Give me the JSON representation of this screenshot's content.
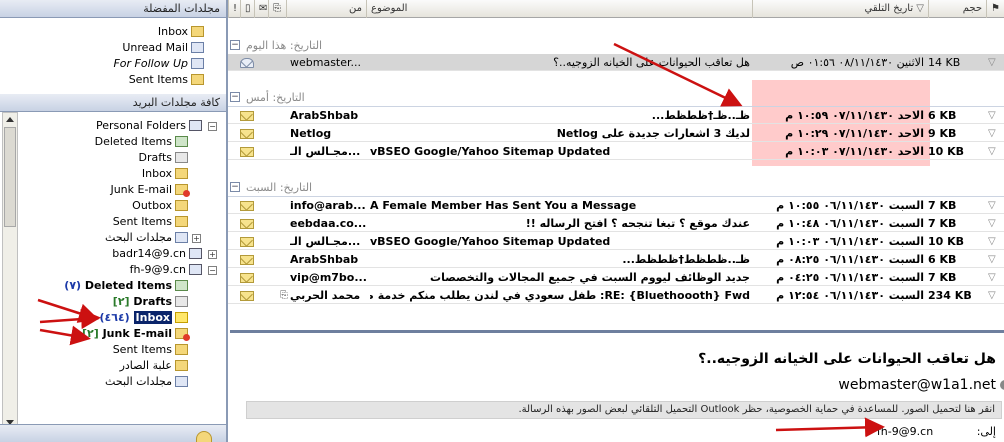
{
  "columns": {
    "size": "حجم",
    "received": "تاريخ التلقي",
    "subject": "الموضوع",
    "from": "من"
  },
  "groups": [
    {
      "label": "التاريخ: هذا اليوم"
    },
    {
      "label": "التاريخ: أمس"
    },
    {
      "label": "التاريخ: السبت"
    }
  ],
  "messages": [
    {
      "from": "webmaster...",
      "subject": "هل تعاقب الحيوانات على الخيانه الزوجيه..؟",
      "received": "الاثنين ٠٨/١١/١٤٣٠ ٠١:٥٦ ص",
      "size": "14 KB",
      "read": true,
      "selected": true,
      "attachment": false
    },
    {
      "from": "ArabShbab",
      "subject": "ظـ..ظـ†ظطظط...",
      "received": "الاحد ٠٧/١١/١٤٣٠ ١٠:٥٩ م",
      "size": "6 KB",
      "read": false,
      "selected": false,
      "attachment": false
    },
    {
      "from": "Netlog",
      "subject": "لديك 3 اشعارات جديدة على Netlog",
      "received": "الاحد ٠٧/١١/١٤٣٠ ١٠:٢٩ م",
      "size": "9 KB",
      "read": false,
      "selected": false,
      "attachment": false
    },
    {
      "from": "مجـالس الـ...",
      "subject": "vBSEO Google/Yahoo Sitemap Updated",
      "received": "الاحد ٠٧/١١/١٤٣٠ ١٠:٠٣ م",
      "size": "10 KB",
      "read": false,
      "selected": false,
      "attachment": false
    },
    {
      "from": "info@arab...",
      "subject": "A Female Member Has Sent You a Message",
      "received": "السبت ٠٦/١١/١٤٣٠ ١٠:٥٥ م",
      "size": "7 KB",
      "read": false,
      "selected": false,
      "attachment": false
    },
    {
      "from": "eebdaa.co...",
      "subject": "عندك موقع ؟ تبغا تنجحه ؟ افتح الرساله !!",
      "received": "السبت ٠٦/١١/١٤٣٠ ١٠:٤٨ م",
      "size": "7 KB",
      "read": false,
      "selected": false,
      "attachment": false
    },
    {
      "from": "مجـالس الـ...",
      "subject": "vBSEO Google/Yahoo Sitemap Updated",
      "received": "السبت ٠٦/١١/١٤٣٠ ١٠:٠٣ م",
      "size": "10 KB",
      "read": false,
      "selected": false,
      "attachment": false
    },
    {
      "from": "ArabShbab",
      "subject": "ظـ..ظطظط†ظطظط...",
      "received": "السبت ٠٦/١١/١٤٣٠ ٠٨:٢٥ م",
      "size": "6 KB",
      "read": false,
      "selected": false,
      "attachment": false
    },
    {
      "from": "vip@m7bo...",
      "subject": "جديد الوظائف ليووم السبت في جميع المجالات والتخصصات",
      "received": "السبت ٠٦/١١/١٤٣٠ ٠٤:٢٥ م",
      "size": "7 KB",
      "read": false,
      "selected": false,
      "attachment": false
    },
    {
      "from": "محمد الحربي",
      "subject": "RE: {Bluethoooth} Fwd: طفل سعودي في لندن يطلب منكم خدمة صغيرة",
      "received": "السبت ٠٦/١١/١٤٣٠ ١٢:٥٤ م",
      "size": "234 KB",
      "read": false,
      "selected": false,
      "attachment": true
    }
  ],
  "folders_pane": {
    "favorites_title": "مجلدات المفضلة",
    "favorites": [
      "Inbox",
      "Unread Mail",
      "For Follow Up",
      "Sent Items"
    ],
    "all_title": "كافة مجلدات البريد",
    "personal": "Personal Folders",
    "personal_items": [
      "Deleted Items",
      "Drafts",
      "Inbox",
      "Junk E-mail",
      "Outbox",
      "Sent Items",
      "مجلدات البحث"
    ],
    "account1": "badr14@9.cn",
    "account2": "fh-9@9.cn",
    "account2_items": {
      "deleted": "Deleted Items",
      "deleted_count": "(٧)",
      "drafts": "Drafts",
      "drafts_count": "[٢]",
      "inbox": "Inbox",
      "inbox_count": "(٤٦٤)",
      "junk": "Junk E-mail",
      "junk_count": "[٢]",
      "sent": "Sent Items",
      "outbox": "علبة الصادر",
      "search": "مجلدات البحث"
    }
  },
  "preview": {
    "subject": "هل تعاقب الحيوانات على الخيانه الزوجيه..؟",
    "sender": "webmaster@w1a1.net",
    "info_bar": "انقر هنا لتحميل الصور. للمساعدة في حماية الخصوصية، حظر Outlook التحميل التلقائي لبعض الصور بهذه الرسالة.",
    "to_label": "إلى:",
    "to_value": "fh-9@9.cn"
  },
  "colors": {
    "annotation_arrow": "#cc1111",
    "highlight": "#ffa0a0",
    "selected_folder": "#0a246a"
  }
}
